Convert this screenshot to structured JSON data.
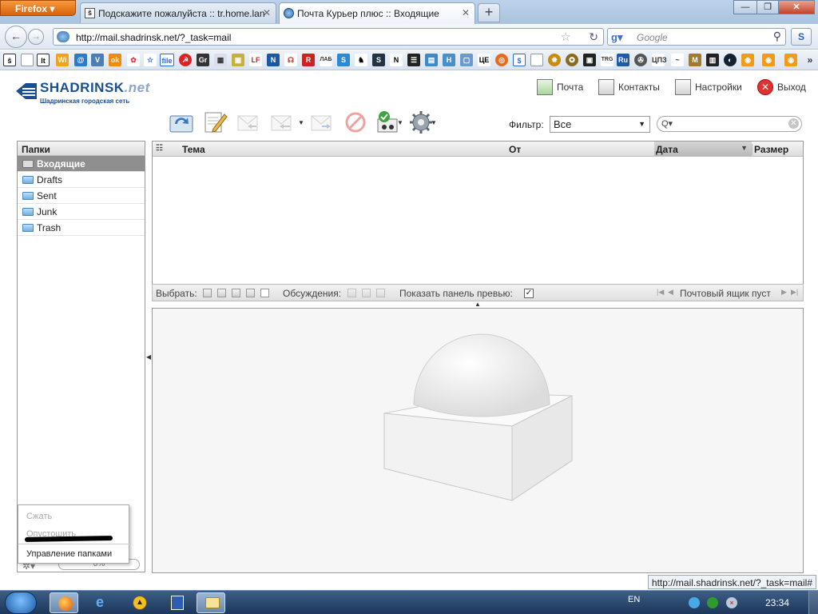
{
  "browser": {
    "menu_label": "Firefox",
    "tabs": [
      {
        "title": "Подскажите пожалуйста :: tr.home.lan",
        "favicon": "site-logo-icon"
      },
      {
        "title": "Почта Курьер плюс :: Входящие",
        "favicon": "mail-globe-icon"
      }
    ],
    "url": "http://mail.shadrinsk.net/?_task=mail",
    "search_placeholder": "Google",
    "window_controls": [
      "minimize",
      "maximize",
      "close"
    ]
  },
  "logo": {
    "name": "SHADRINSK",
    "tld": ".net",
    "tagline": "Шадринская городская сеть"
  },
  "topnav": {
    "mail": "Почта",
    "contacts": "Контакты",
    "settings": "Настройки",
    "logout": "Выход"
  },
  "toolbar": {
    "buttons": [
      "check-mail",
      "compose",
      "reply",
      "reply-all",
      "forward",
      "delete",
      "mark",
      "more"
    ],
    "filter_label": "Фильтр:",
    "filter_value": "Все",
    "search_value": ""
  },
  "folders": {
    "header": "Папки",
    "items": [
      {
        "label": "Входящие",
        "selected": true
      },
      {
        "label": "Drafts",
        "selected": false
      },
      {
        "label": "Sent",
        "selected": false
      },
      {
        "label": "Junk",
        "selected": false
      },
      {
        "label": "Trash",
        "selected": false
      }
    ],
    "menu": {
      "compact": "Сжать",
      "empty": "Опустошить",
      "manage": "Управление папками"
    },
    "quota": "0%"
  },
  "messagelist": {
    "columns": {
      "subject": "Тема",
      "from": "От",
      "date": "Дата",
      "size": "Размер"
    },
    "rows": []
  },
  "listfooter": {
    "select_label": "Выбрать:",
    "threads_label": "Обсуждения:",
    "preview_label": "Показать панель превью:",
    "preview_checked": true,
    "count_text": "Почтовый ящик пуст"
  },
  "statusbar": {
    "url": "http://mail.shadrinsk.net/?_task=mail#"
  },
  "taskbar": {
    "language": "EN",
    "time": "23:34"
  },
  "colors": {
    "selected_folder_bg": "#8f8f8f",
    "logo_blue": "#1b4f92",
    "taskbar_bg": "#1c3759"
  }
}
